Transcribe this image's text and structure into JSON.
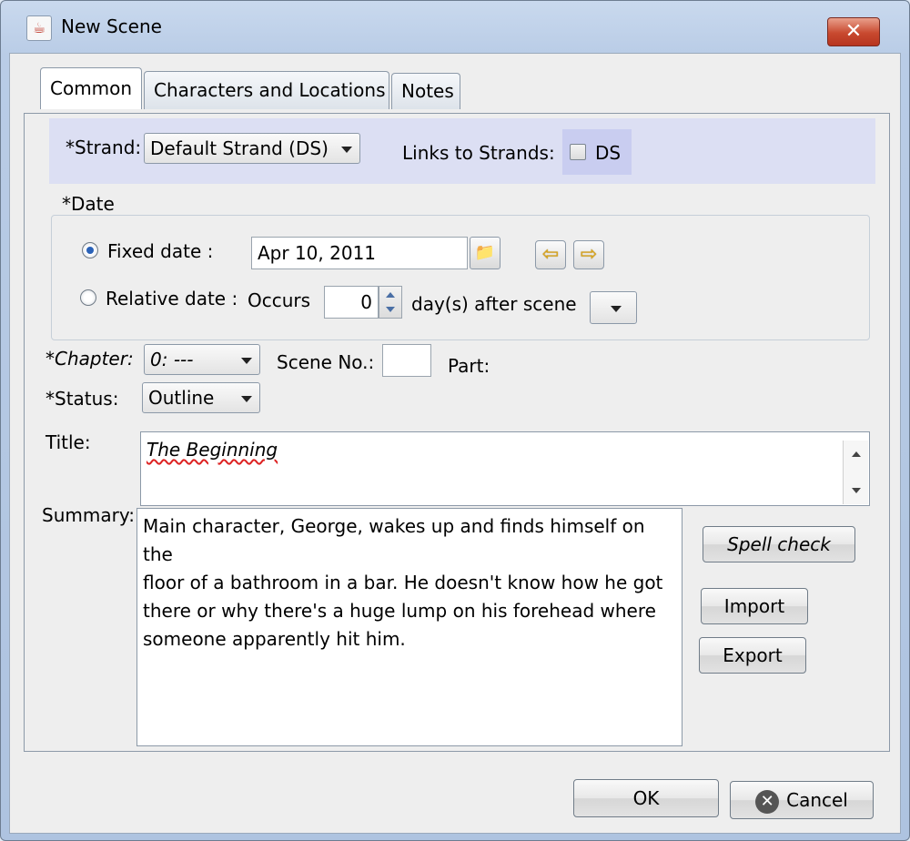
{
  "window": {
    "title": "New Scene",
    "close_glyph": "✕",
    "app_icon": "java-cup-icon"
  },
  "tabs": [
    {
      "label": "Common",
      "active": true
    },
    {
      "label": "Characters and Locations",
      "active": false
    },
    {
      "label": "Notes",
      "active": false
    }
  ],
  "strand": {
    "label": "*Strand:",
    "selected": "Default Strand (DS)",
    "links_label": "Links to Strands:",
    "link_option": "DS",
    "link_checked": false,
    "band_color": "#dcdff3"
  },
  "date": {
    "group_label": "*Date",
    "fixed_label": "Fixed date :",
    "fixed_selected": true,
    "fixed_value": "Apr 10, 2011",
    "relative_label": "Relative date :",
    "occurs_label": "Occurs",
    "occurs_value": "0",
    "after_label": "day(s) after scene",
    "prev_glyph": "⇦",
    "next_glyph": "⇨"
  },
  "chapter": {
    "label": "*Chapter:",
    "selected": "0: ---"
  },
  "scene_no": {
    "label": "Scene No.:",
    "value": ""
  },
  "part": {
    "label": "Part:"
  },
  "status": {
    "label": "*Status:",
    "selected": "Outline"
  },
  "title_field": {
    "label": "Title:",
    "value": "The Beginning"
  },
  "summary": {
    "label": "Summary:",
    "lines": [
      "Main character, George, wakes up and finds himself on the",
      "floor of a bathroom in a bar. He doesn't know how he got",
      "there or why there's a huge lump on his forehead where",
      "someone apparently hit him."
    ]
  },
  "buttons": {
    "spell_check": "Spell check",
    "import": "Import",
    "export": "Export",
    "ok": "OK",
    "cancel": "Cancel"
  }
}
